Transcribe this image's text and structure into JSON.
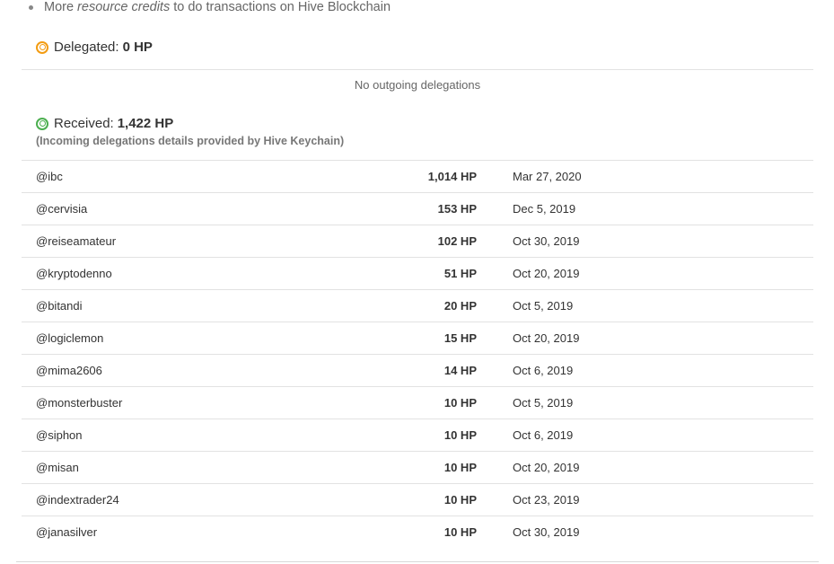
{
  "bullet": {
    "prefix": "More",
    "emphasis": "resource credits",
    "suffix": "to do transactions on Hive Blockchain"
  },
  "delegated": {
    "label": "Delegated:",
    "value": "0 HP",
    "empty_message": "No outgoing delegations",
    "icon": "ring-icon",
    "icon_color": "#f39c12"
  },
  "received": {
    "label": "Received:",
    "value": "1,422 HP",
    "note": "(Incoming delegations details provided by Hive Keychain)",
    "icon": "ring-icon",
    "icon_color": "#4caf50"
  },
  "incoming": [
    {
      "user": "@ibc",
      "amount": "1,014 HP",
      "date": "Mar 27, 2020"
    },
    {
      "user": "@cervisia",
      "amount": "153 HP",
      "date": "Dec 5, 2019"
    },
    {
      "user": "@reiseamateur",
      "amount": "102 HP",
      "date": "Oct 30, 2019"
    },
    {
      "user": "@kryptodenno",
      "amount": "51 HP",
      "date": "Oct 20, 2019"
    },
    {
      "user": "@bitandi",
      "amount": "20 HP",
      "date": "Oct 5, 2019"
    },
    {
      "user": "@logiclemon",
      "amount": "15 HP",
      "date": "Oct 20, 2019"
    },
    {
      "user": "@mima2606",
      "amount": "14 HP",
      "date": "Oct 6, 2019"
    },
    {
      "user": "@monsterbuster",
      "amount": "10 HP",
      "date": "Oct 5, 2019"
    },
    {
      "user": "@siphon",
      "amount": "10 HP",
      "date": "Oct 6, 2019"
    },
    {
      "user": "@misan",
      "amount": "10 HP",
      "date": "Oct 20, 2019"
    },
    {
      "user": "@indextrader24",
      "amount": "10 HP",
      "date": "Oct 23, 2019"
    },
    {
      "user": "@janasilver",
      "amount": "10 HP",
      "date": "Oct 30, 2019"
    }
  ]
}
